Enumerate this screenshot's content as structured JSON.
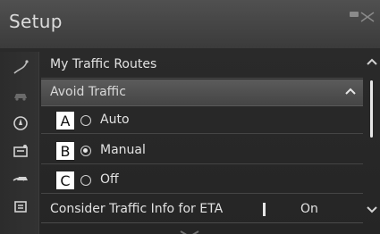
{
  "window": {
    "title": "Setup"
  },
  "sidebar": {
    "icons": [
      "route-icon",
      "car-icon",
      "compass-icon",
      "traffic-info-icon",
      "avoid-traffic-icon",
      "eta-icon"
    ]
  },
  "list": {
    "my_traffic_routes": "My Traffic Routes",
    "avoid_traffic": "Avoid Traffic",
    "options": [
      {
        "callout": "A",
        "label": "Auto",
        "selected": false
      },
      {
        "callout": "B",
        "label": "Manual",
        "selected": true
      },
      {
        "callout": "C",
        "label": "Off",
        "selected": false
      }
    ],
    "consider_eta": {
      "label": "Consider Traffic Info for ETA",
      "value": "On"
    }
  }
}
